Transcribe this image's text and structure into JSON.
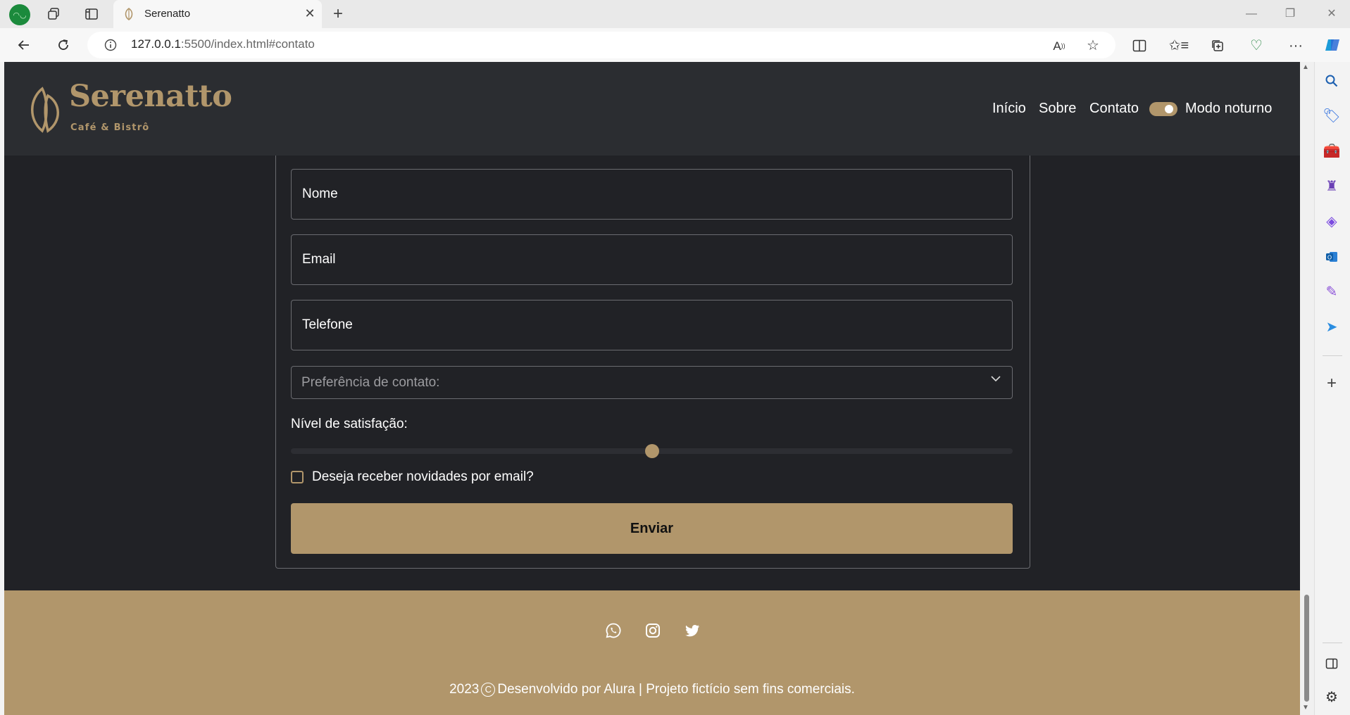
{
  "browser": {
    "tab_title": "Serenatto",
    "url_host": "127.0.0.1",
    "url_rest": ":5500/index.html#contato"
  },
  "site": {
    "brand": "Serenatto",
    "tagline": "Café & Bistrô",
    "nav": [
      {
        "label": "Início"
      },
      {
        "label": "Sobre"
      },
      {
        "label": "Contato"
      }
    ],
    "night_mode_label": "Modo noturno",
    "night_mode_on": true,
    "accent_color": "#b1966b",
    "background_color": "#212226"
  },
  "form": {
    "name_placeholder": "Nome",
    "email_placeholder": "Email",
    "phone_placeholder": "Telefone",
    "contact_pref_placeholder": "Preferência de contato:",
    "satisfaction_label": "Nível de satisfação:",
    "satisfaction_value": 50,
    "newsletter_label": "Deseja receber novidades por email?",
    "newsletter_checked": false,
    "submit_label": "Enviar"
  },
  "footer": {
    "social_icons": [
      "whatsapp-icon",
      "instagram-icon",
      "twitter-icon"
    ],
    "copyright_year": "2023",
    "copyright_text": "Desenvolvido por Alura | Projeto fictício sem fins comerciais."
  }
}
